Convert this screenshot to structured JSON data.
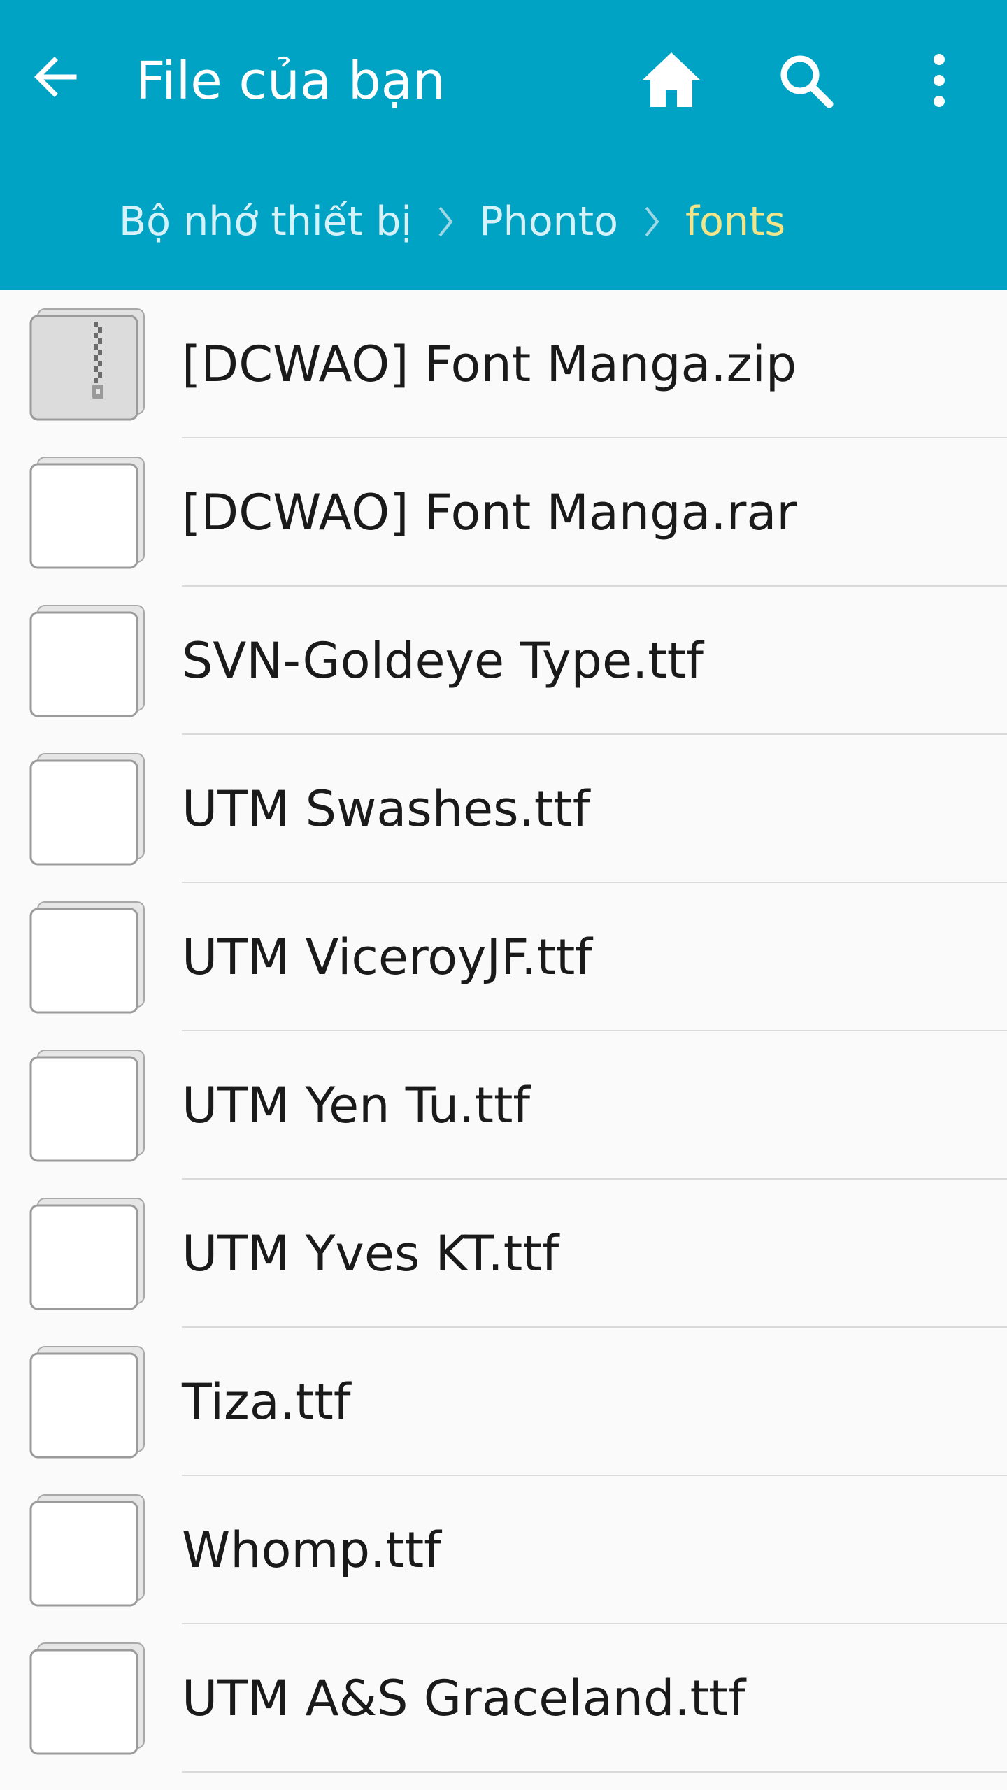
{
  "header": {
    "title": "File của bạn",
    "back_icon": "arrow-left-icon",
    "home_icon": "home-icon",
    "search_icon": "search-icon",
    "more_icon": "more-vertical-icon",
    "background_color": "#00a3c4"
  },
  "breadcrumb": {
    "items": [
      {
        "label": "Bộ nhớ thiết bị"
      },
      {
        "label": "Phonto"
      },
      {
        "label": "fonts"
      }
    ],
    "separator_icon": "chevron-right-icon",
    "current_color": "#f3e488"
  },
  "files": [
    {
      "name": "[DCWAO] Font Manga.zip",
      "icon": "zip-file-icon"
    },
    {
      "name": "[DCWAO] Font Manga.rar",
      "icon": "file-icon"
    },
    {
      "name": "SVN-Goldeye Type.ttf",
      "icon": "file-icon"
    },
    {
      "name": "UTM Swashes.ttf",
      "icon": "file-icon"
    },
    {
      "name": "UTM ViceroyJF.ttf",
      "icon": "file-icon"
    },
    {
      "name": "UTM Yen Tu.ttf",
      "icon": "file-icon"
    },
    {
      "name": "UTM Yves KT.ttf",
      "icon": "file-icon"
    },
    {
      "name": "Tiza.ttf",
      "icon": "file-icon"
    },
    {
      "name": "Whomp.ttf",
      "icon": "file-icon"
    },
    {
      "name": "UTM A&S Graceland.ttf",
      "icon": "file-icon"
    }
  ]
}
